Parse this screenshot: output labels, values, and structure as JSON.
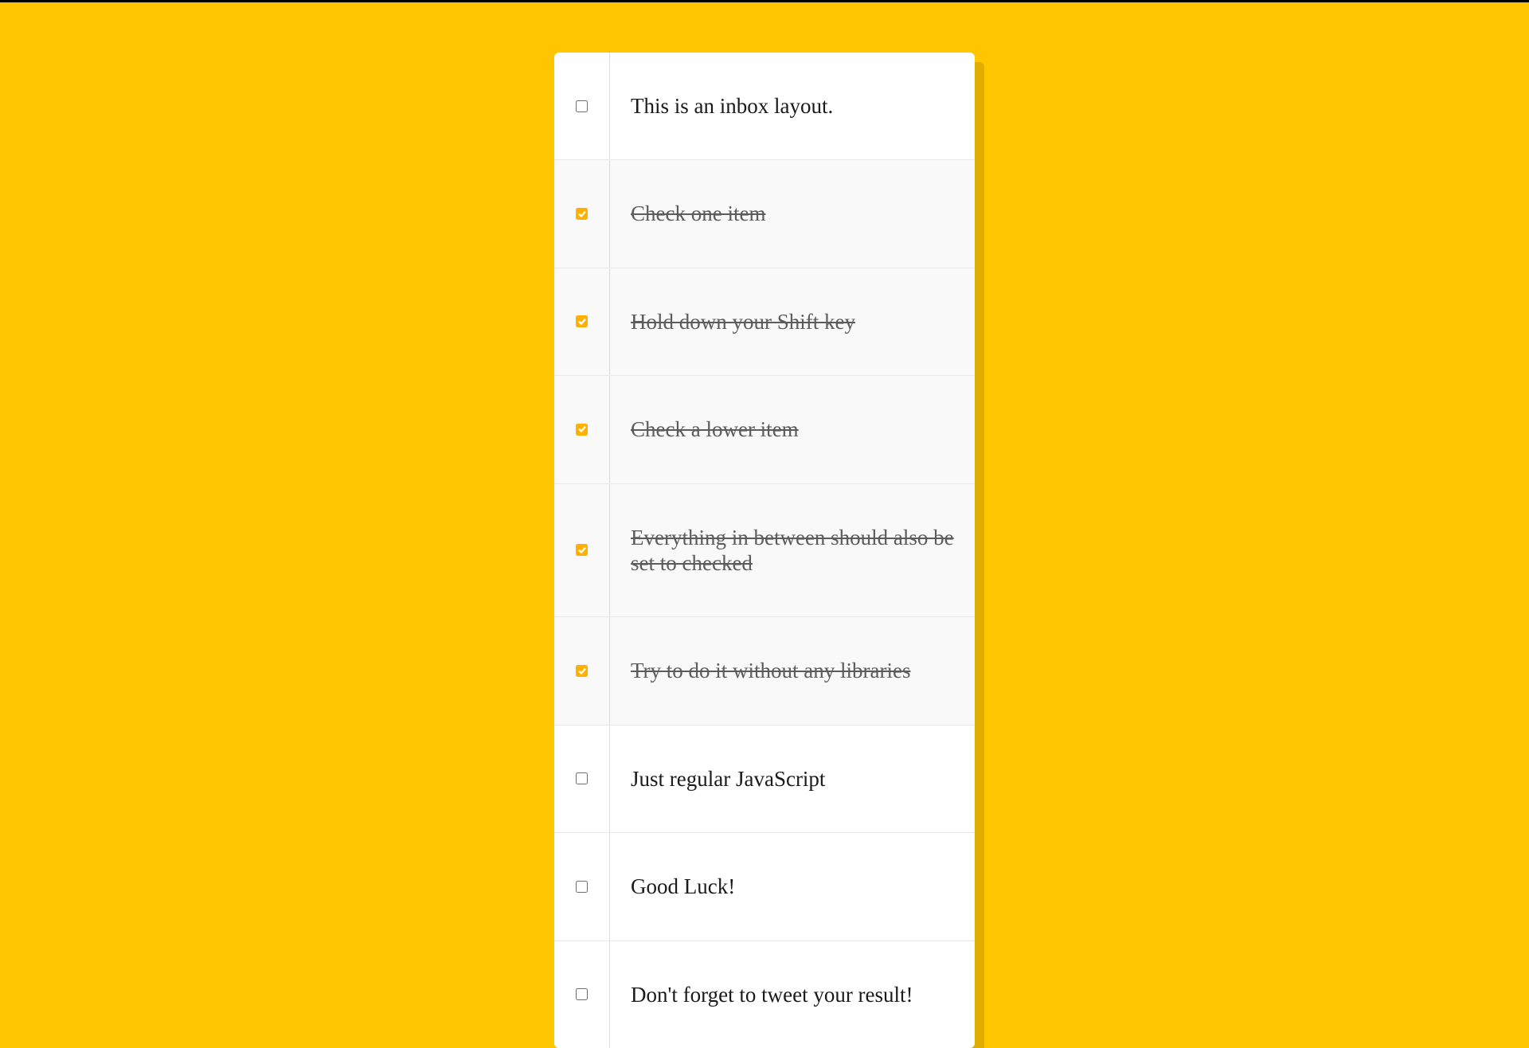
{
  "colors": {
    "accent": "#ffc600",
    "checkbox_checked": "#ffb000"
  },
  "inbox": {
    "items": [
      {
        "label": "This is an inbox layout.",
        "checked": false
      },
      {
        "label": "Check one item",
        "checked": true
      },
      {
        "label": "Hold down your Shift key",
        "checked": true
      },
      {
        "label": "Check a lower item",
        "checked": true
      },
      {
        "label": "Everything in between should also be set to checked",
        "checked": true
      },
      {
        "label": "Try to do it without any libraries",
        "checked": true
      },
      {
        "label": "Just regular JavaScript",
        "checked": false
      },
      {
        "label": "Good Luck!",
        "checked": false
      },
      {
        "label": "Don't forget to tweet your result!",
        "checked": false
      }
    ]
  }
}
